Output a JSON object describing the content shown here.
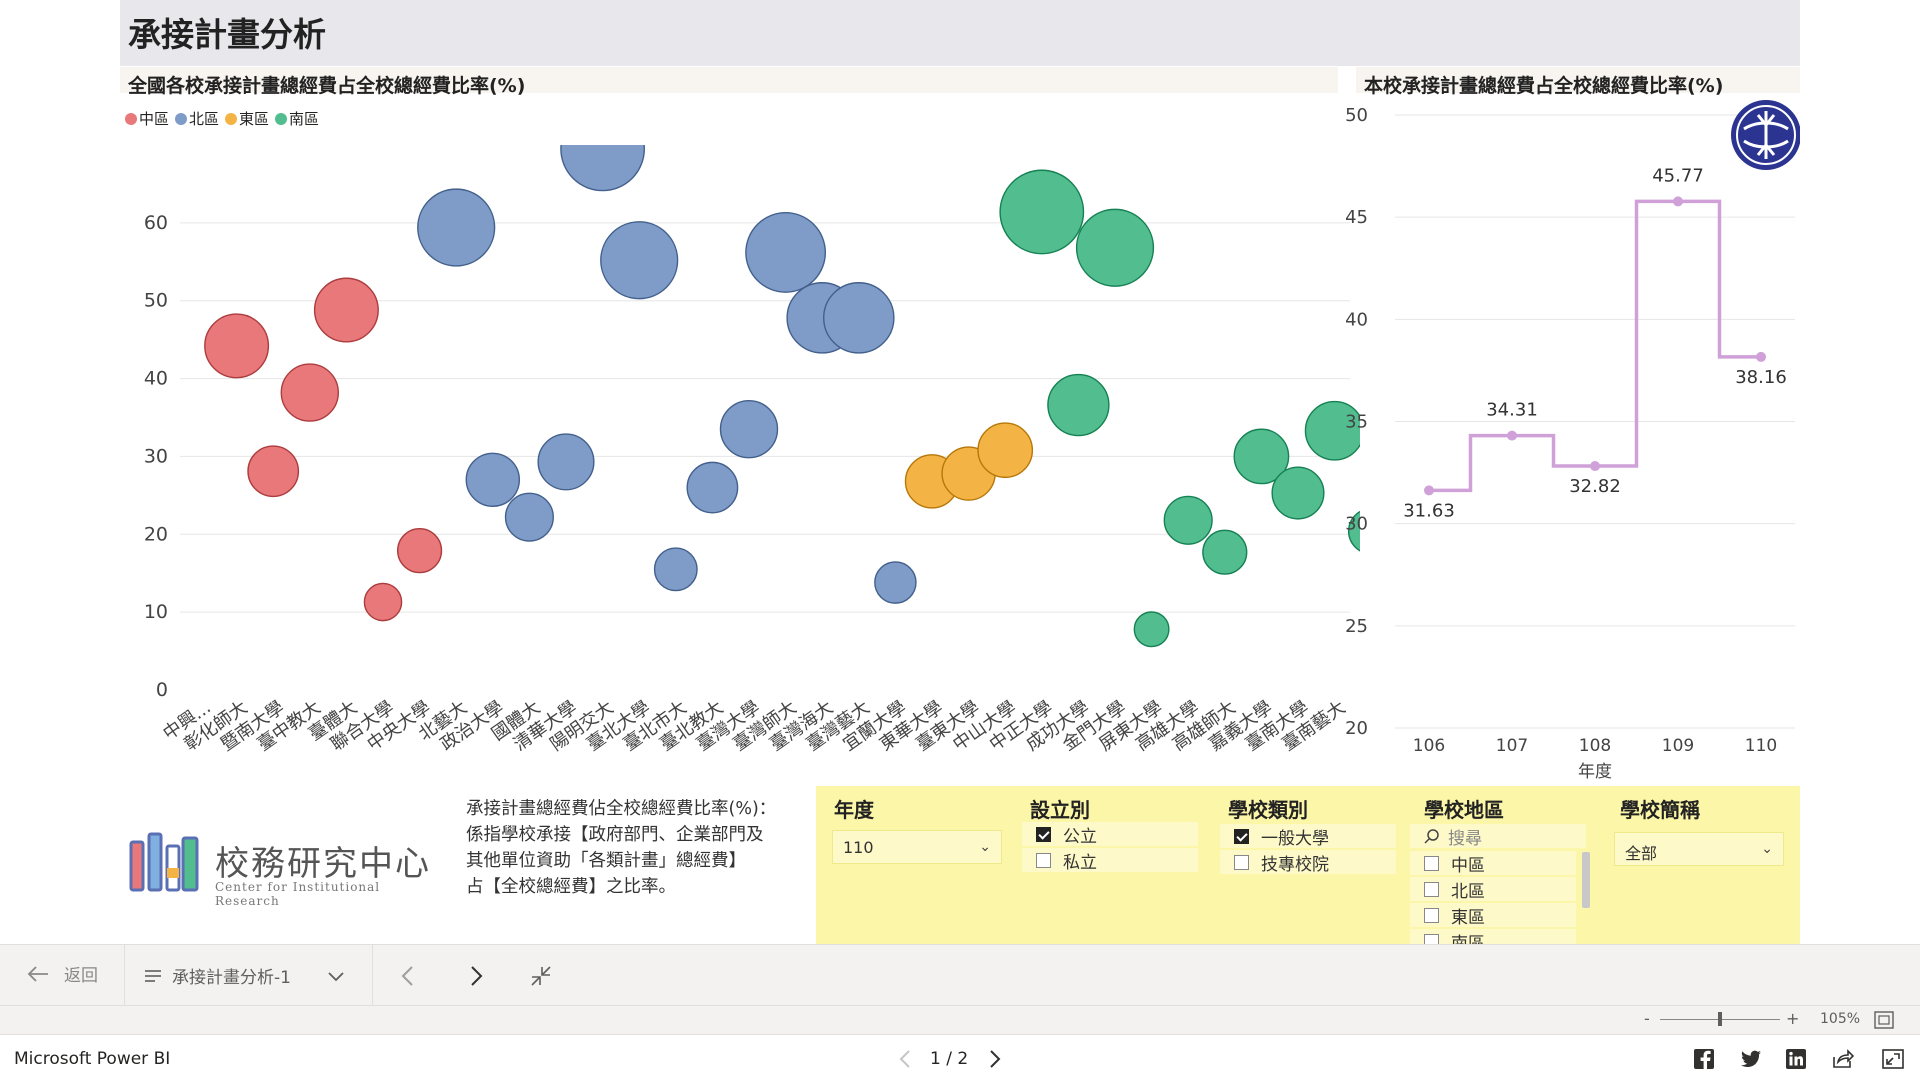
{
  "report": {
    "title": "承接計畫分析",
    "left_chart_title": "全國各校承接計畫總經費占全校總經費比率(%)",
    "right_chart_title": "本校承接計畫總經費占全校總經費比率(%)"
  },
  "legend": [
    {
      "label": "中區",
      "color": "#e8787a"
    },
    {
      "label": "北區",
      "color": "#7f9cc8"
    },
    {
      "label": "東區",
      "color": "#f3b445"
    },
    {
      "label": "南區",
      "color": "#52bd8f"
    }
  ],
  "colors": {
    "中區": "#e8787a",
    "北區": "#7f9cc8",
    "東區": "#f3b445",
    "南區": "#52bd8f",
    "line": "#cfa1d8"
  },
  "chart_data": [
    {
      "type": "scatter",
      "title": "全國各校承接計畫總經費占全校總經費比率(%)",
      "ylim": [
        0,
        70
      ],
      "yticks": [
        0,
        10,
        20,
        30,
        40,
        50,
        60
      ],
      "grid": true,
      "legend_position": "top-left",
      "categories": [
        "中興...",
        "彰化師大",
        "暨南大學",
        "臺中教大",
        "臺體大",
        "聯合大學",
        "中央大學",
        "北藝大",
        "政治大學",
        "國體大",
        "清華大學",
        "陽明交大",
        "臺北大學",
        "臺北市大",
        "臺北教大",
        "臺灣大學",
        "臺灣師大",
        "臺灣海大",
        "臺灣藝大",
        "宜蘭大學",
        "東華大學",
        "臺東大學",
        "中山大學",
        "中正大學",
        "成功大學",
        "金門大學",
        "屏東大學",
        "高雄大學",
        "高雄師大",
        "嘉義大學",
        "臺南大學",
        "臺南藝大"
      ],
      "points": [
        {
          "x": "彰化師大",
          "y": 44.2,
          "region": "中區",
          "size": 3
        },
        {
          "x": "暨南大學",
          "y": 28.1,
          "region": "中區",
          "size": 2
        },
        {
          "x": "臺中教大",
          "y": 38.2,
          "region": "中區",
          "size": 2.5
        },
        {
          "x": "臺體大",
          "y": 48.8,
          "region": "中區",
          "size": 3
        },
        {
          "x": "聯合大學",
          "y": 11.3,
          "region": "中區",
          "size": 1
        },
        {
          "x": "中央大學",
          "y": 17.9,
          "region": "中區",
          "size": 1.5
        },
        {
          "x": "北藝大",
          "y": 59.4,
          "region": "北區",
          "size": 4
        },
        {
          "x": "政治大學",
          "y": 27.0,
          "region": "北區",
          "size": 2.2
        },
        {
          "x": "國體大",
          "y": 22.2,
          "region": "北區",
          "size": 1.8
        },
        {
          "x": "清華大學",
          "y": 29.3,
          "region": "北區",
          "size": 2.4
        },
        {
          "x": "陽明交大",
          "y": 69.5,
          "region": "北區",
          "size": 4.5
        },
        {
          "x": "臺北大學",
          "y": 55.2,
          "region": "北區",
          "size": 4
        },
        {
          "x": "臺北市大",
          "y": 15.5,
          "region": "北區",
          "size": 1.4
        },
        {
          "x": "臺北教大",
          "y": 26.0,
          "region": "北區",
          "size": 2
        },
        {
          "x": "臺灣大學",
          "y": 33.5,
          "region": "北區",
          "size": 2.5
        },
        {
          "x": "臺灣師大",
          "y": 56.2,
          "region": "北區",
          "size": 4.2
        },
        {
          "x": "臺灣海大",
          "y": 47.8,
          "region": "北區",
          "size": 3.5
        },
        {
          "x": "臺灣藝大",
          "y": 47.8,
          "region": "北區",
          "size": 3.5
        },
        {
          "x": "宜蘭大學",
          "y": 13.8,
          "region": "北區",
          "size": 1.3
        },
        {
          "x": "東華大學",
          "y": 26.8,
          "region": "東區",
          "size": 2.2
        },
        {
          "x": "臺東大學",
          "y": 27.8,
          "region": "東區",
          "size": 2.2
        },
        {
          "x": "中山大學",
          "y": 30.8,
          "region": "東區",
          "size": 2.3
        },
        {
          "x": "中正大學",
          "y": 61.4,
          "region": "南區",
          "size": 4.5
        },
        {
          "x": "成功大學",
          "y": 36.6,
          "region": "南區",
          "size": 2.8
        },
        {
          "x": "金門大學",
          "y": 56.8,
          "region": "南區",
          "size": 4
        },
        {
          "x": "屏東大學",
          "y": 7.8,
          "region": "南區",
          "size": 0.8
        },
        {
          "x": "高雄大學",
          "y": 21.8,
          "region": "南區",
          "size": 1.8
        },
        {
          "x": "高雄師大",
          "y": 17.7,
          "region": "南區",
          "size": 1.5
        },
        {
          "x": "嘉義大學",
          "y": 30.0,
          "region": "南區",
          "size": 2.3
        },
        {
          "x": "臺南大學",
          "y": 25.3,
          "region": "南區",
          "size": 2.1
        },
        {
          "x": "臺南藝大",
          "y": 33.3,
          "region": "南區",
          "size": 2.6
        },
        {
          "x": "",
          "y": 20.4,
          "region": "南區",
          "size": 1.6
        }
      ]
    },
    {
      "type": "line",
      "title": "本校承接計畫總經費占全校總經費比率(%)",
      "x": [
        "106",
        "107",
        "108",
        "109",
        "110"
      ],
      "values": [
        31.63,
        34.31,
        32.82,
        45.77,
        38.16
      ],
      "xlabel": "年度",
      "ylim": [
        20,
        50
      ],
      "yticks": [
        20,
        25,
        30,
        35,
        40,
        45,
        50
      ],
      "step": true,
      "grid": true
    }
  ],
  "logo": {
    "title": "校務研究中心",
    "subtitle": "Center for Institutional Research"
  },
  "description": {
    "line1": "承接計畫總經費佔全校總經費比率(%)：",
    "line2": "係指學校承接【政府部門、企業部門及",
    "line3": "其他單位資助「各類計畫」總經費】",
    "line4": "占【全校總經費】之比率。"
  },
  "slicers": {
    "year": {
      "header": "年度",
      "selected": "110"
    },
    "establish": {
      "header": "設立別",
      "options": [
        {
          "label": "公立",
          "checked": true
        },
        {
          "label": "私立",
          "checked": false
        }
      ]
    },
    "school_type": {
      "header": "學校類別",
      "options": [
        {
          "label": "一般大學",
          "checked": true
        },
        {
          "label": "技專校院",
          "checked": false
        }
      ]
    },
    "region": {
      "header": "學校地區",
      "search_placeholder": "搜尋",
      "options": [
        {
          "label": "中區",
          "checked": false
        },
        {
          "label": "北區",
          "checked": false
        },
        {
          "label": "東區",
          "checked": false
        },
        {
          "label": "南區",
          "checked": false
        }
      ]
    },
    "school_name": {
      "header": "學校簡稱",
      "selected": "全部"
    }
  },
  "nav": {
    "back": "返回",
    "page_name": "承接計畫分析-1"
  },
  "zoom": {
    "level": "105%"
  },
  "footer": {
    "app_name": "Microsoft Power BI",
    "pager": "1 / 2"
  }
}
